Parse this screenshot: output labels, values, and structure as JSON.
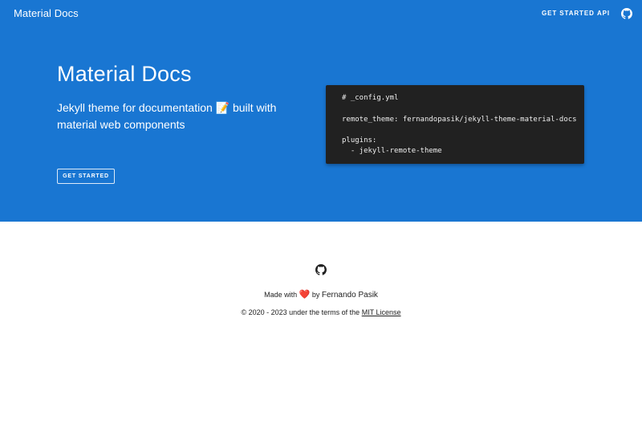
{
  "header": {
    "brand": "Material Docs",
    "nav": {
      "get_started": "GET STARTED",
      "api": "API"
    },
    "github_icon": "github-icon"
  },
  "hero": {
    "title": "Material Docs",
    "subtitle": "Jekyll theme for documentation 📝 built with material web components",
    "button_label": "GET STARTED",
    "background_color": "#1976d2"
  },
  "code": {
    "line1": "# _config.yml",
    "line2": "remote_theme: fernandopasik/jekyll-theme-material-docs",
    "line3": "plugins:",
    "line4": "  - jekyll-remote-theme"
  },
  "footer": {
    "github_icon": "github-icon",
    "made_with_prefix": "Made with",
    "heart": "❤️",
    "by": "by",
    "author": "Fernando Pasik",
    "copyright_prefix": "© 2020 - 2023 under the terms of the",
    "license": "MIT License"
  }
}
